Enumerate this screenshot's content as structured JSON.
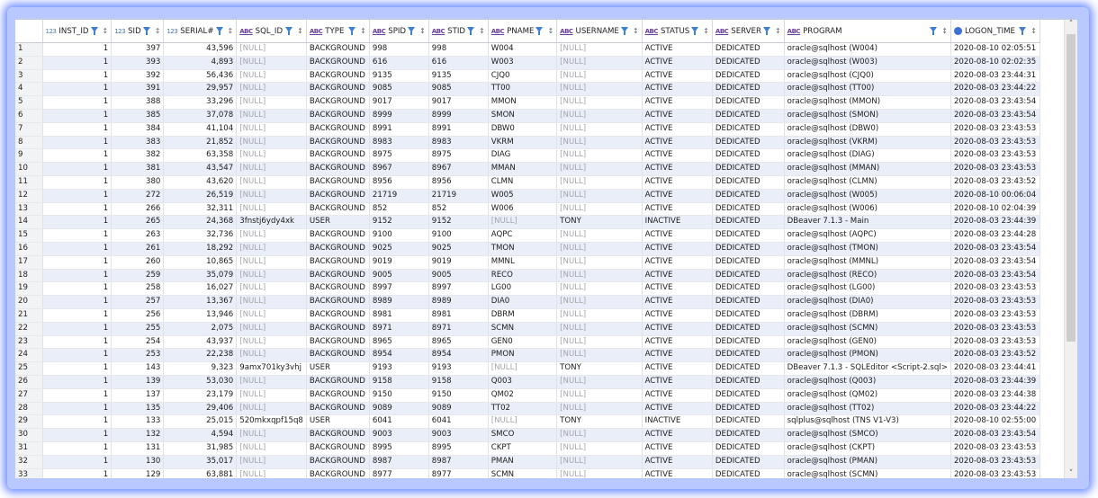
{
  "columns": [
    {
      "label": "",
      "icon": ""
    },
    {
      "label": "INST_ID",
      "icon": "123"
    },
    {
      "label": "SID",
      "icon": "123"
    },
    {
      "label": "SERIAL#",
      "icon": "123"
    },
    {
      "label": "SQL_ID",
      "icon": "ABC"
    },
    {
      "label": "TYPE",
      "icon": "ABC"
    },
    {
      "label": "SPID",
      "icon": "ABC"
    },
    {
      "label": "STID",
      "icon": "ABC"
    },
    {
      "label": "PNAME",
      "icon": "ABC"
    },
    {
      "label": "USERNAME",
      "icon": "ABC"
    },
    {
      "label": "STATUS",
      "icon": "ABC"
    },
    {
      "label": "SERVER",
      "icon": "ABC"
    },
    {
      "label": "PROGRAM",
      "icon": "ABC"
    },
    {
      "label": "LOGON_TIME",
      "icon": "clock"
    }
  ],
  "null_text": "[NULL]",
  "rows": [
    [
      "1",
      "1",
      "397",
      "43,596",
      "[NULL]",
      "BACKGROUND",
      "998",
      "998",
      "W004",
      "[NULL]",
      "ACTIVE",
      "DEDICATED",
      "oracle@sqlhost (W004)",
      "2020-08-10 02:05:51"
    ],
    [
      "2",
      "1",
      "393",
      "4,893",
      "[NULL]",
      "BACKGROUND",
      "616",
      "616",
      "W003",
      "[NULL]",
      "ACTIVE",
      "DEDICATED",
      "oracle@sqlhost (W003)",
      "2020-08-10 02:02:35"
    ],
    [
      "3",
      "1",
      "392",
      "56,436",
      "[NULL]",
      "BACKGROUND",
      "9135",
      "9135",
      "CJQ0",
      "[NULL]",
      "ACTIVE",
      "DEDICATED",
      "oracle@sqlhost (CJQ0)",
      "2020-08-03 23:44:31"
    ],
    [
      "4",
      "1",
      "391",
      "29,957",
      "[NULL]",
      "BACKGROUND",
      "9085",
      "9085",
      "TT00",
      "[NULL]",
      "ACTIVE",
      "DEDICATED",
      "oracle@sqlhost (TT00)",
      "2020-08-03 23:44:22"
    ],
    [
      "5",
      "1",
      "388",
      "33,296",
      "[NULL]",
      "BACKGROUND",
      "9017",
      "9017",
      "MMON",
      "[NULL]",
      "ACTIVE",
      "DEDICATED",
      "oracle@sqlhost (MMON)",
      "2020-08-03 23:43:54"
    ],
    [
      "6",
      "1",
      "385",
      "37,078",
      "[NULL]",
      "BACKGROUND",
      "8999",
      "8999",
      "SMON",
      "[NULL]",
      "ACTIVE",
      "DEDICATED",
      "oracle@sqlhost (SMON)",
      "2020-08-03 23:43:54"
    ],
    [
      "7",
      "1",
      "384",
      "41,104",
      "[NULL]",
      "BACKGROUND",
      "8991",
      "8991",
      "DBW0",
      "[NULL]",
      "ACTIVE",
      "DEDICATED",
      "oracle@sqlhost (DBW0)",
      "2020-08-03 23:43:53"
    ],
    [
      "8",
      "1",
      "383",
      "21,852",
      "[NULL]",
      "BACKGROUND",
      "8983",
      "8983",
      "VKRM",
      "[NULL]",
      "ACTIVE",
      "DEDICATED",
      "oracle@sqlhost (VKRM)",
      "2020-08-03 23:43:53"
    ],
    [
      "9",
      "1",
      "382",
      "63,358",
      "[NULL]",
      "BACKGROUND",
      "8975",
      "8975",
      "DIAG",
      "[NULL]",
      "ACTIVE",
      "DEDICATED",
      "oracle@sqlhost (DIAG)",
      "2020-08-03 23:43:53"
    ],
    [
      "10",
      "1",
      "381",
      "43,547",
      "[NULL]",
      "BACKGROUND",
      "8967",
      "8967",
      "MMAN",
      "[NULL]",
      "ACTIVE",
      "DEDICATED",
      "oracle@sqlhost (MMAN)",
      "2020-08-03 23:43:53"
    ],
    [
      "11",
      "1",
      "380",
      "43,620",
      "[NULL]",
      "BACKGROUND",
      "8956",
      "8956",
      "CLMN",
      "[NULL]",
      "ACTIVE",
      "DEDICATED",
      "oracle@sqlhost (CLMN)",
      "2020-08-03 23:43:52"
    ],
    [
      "12",
      "1",
      "272",
      "26,519",
      "[NULL]",
      "BACKGROUND",
      "21719",
      "21719",
      "W005",
      "[NULL]",
      "ACTIVE",
      "DEDICATED",
      "oracle@sqlhost (W005)",
      "2020-08-10 00:06:04"
    ],
    [
      "13",
      "1",
      "266",
      "32,311",
      "[NULL]",
      "BACKGROUND",
      "852",
      "852",
      "W006",
      "[NULL]",
      "ACTIVE",
      "DEDICATED",
      "oracle@sqlhost (W006)",
      "2020-08-10 02:04:39"
    ],
    [
      "14",
      "1",
      "265",
      "24,368",
      "3fnstj6ydy4xk",
      "USER",
      "9152",
      "9152",
      "[NULL]",
      "TONY",
      "INACTIVE",
      "DEDICATED",
      "DBeaver 7.1.3 - Main",
      "2020-08-03 23:44:39"
    ],
    [
      "15",
      "1",
      "263",
      "32,736",
      "[NULL]",
      "BACKGROUND",
      "9100",
      "9100",
      "AQPC",
      "[NULL]",
      "ACTIVE",
      "DEDICATED",
      "oracle@sqlhost (AQPC)",
      "2020-08-03 23:44:28"
    ],
    [
      "16",
      "1",
      "261",
      "18,292",
      "[NULL]",
      "BACKGROUND",
      "9025",
      "9025",
      "TMON",
      "[NULL]",
      "ACTIVE",
      "DEDICATED",
      "oracle@sqlhost (TMON)",
      "2020-08-03 23:43:54"
    ],
    [
      "17",
      "1",
      "260",
      "10,865",
      "[NULL]",
      "BACKGROUND",
      "9019",
      "9019",
      "MMNL",
      "[NULL]",
      "ACTIVE",
      "DEDICATED",
      "oracle@sqlhost (MMNL)",
      "2020-08-03 23:43:54"
    ],
    [
      "18",
      "1",
      "259",
      "35,079",
      "[NULL]",
      "BACKGROUND",
      "9005",
      "9005",
      "RECO",
      "[NULL]",
      "ACTIVE",
      "DEDICATED",
      "oracle@sqlhost (RECO)",
      "2020-08-03 23:43:54"
    ],
    [
      "19",
      "1",
      "258",
      "16,027",
      "[NULL]",
      "BACKGROUND",
      "8997",
      "8997",
      "LG00",
      "[NULL]",
      "ACTIVE",
      "DEDICATED",
      "oracle@sqlhost (LG00)",
      "2020-08-03 23:43:53"
    ],
    [
      "20",
      "1",
      "257",
      "13,367",
      "[NULL]",
      "BACKGROUND",
      "8989",
      "8989",
      "DIA0",
      "[NULL]",
      "ACTIVE",
      "DEDICATED",
      "oracle@sqlhost (DIA0)",
      "2020-08-03 23:43:53"
    ],
    [
      "21",
      "1",
      "256",
      "13,946",
      "[NULL]",
      "BACKGROUND",
      "8981",
      "8981",
      "DBRM",
      "[NULL]",
      "ACTIVE",
      "DEDICATED",
      "oracle@sqlhost (DBRM)",
      "2020-08-03 23:43:53"
    ],
    [
      "22",
      "1",
      "255",
      "2,075",
      "[NULL]",
      "BACKGROUND",
      "8971",
      "8971",
      "SCMN",
      "[NULL]",
      "ACTIVE",
      "DEDICATED",
      "oracle@sqlhost (SCMN)",
      "2020-08-03 23:43:53"
    ],
    [
      "23",
      "1",
      "254",
      "43,937",
      "[NULL]",
      "BACKGROUND",
      "8965",
      "8965",
      "GEN0",
      "[NULL]",
      "ACTIVE",
      "DEDICATED",
      "oracle@sqlhost (GEN0)",
      "2020-08-03 23:43:53"
    ],
    [
      "24",
      "1",
      "253",
      "22,238",
      "[NULL]",
      "BACKGROUND",
      "8954",
      "8954",
      "PMON",
      "[NULL]",
      "ACTIVE",
      "DEDICATED",
      "oracle@sqlhost (PMON)",
      "2020-08-03 23:43:52"
    ],
    [
      "25",
      "1",
      "143",
      "9,323",
      "9amx701ky3vhj",
      "USER",
      "9193",
      "9193",
      "[NULL]",
      "TONY",
      "ACTIVE",
      "DEDICATED",
      "DBeaver 7.1.3 - SQLEditor <Script-2.sql>",
      "2020-08-03 23:44:41"
    ],
    [
      "26",
      "1",
      "139",
      "53,030",
      "[NULL]",
      "BACKGROUND",
      "9158",
      "9158",
      "Q003",
      "[NULL]",
      "ACTIVE",
      "DEDICATED",
      "oracle@sqlhost (Q003)",
      "2020-08-03 23:44:39"
    ],
    [
      "27",
      "1",
      "137",
      "23,179",
      "[NULL]",
      "BACKGROUND",
      "9150",
      "9150",
      "QM02",
      "[NULL]",
      "ACTIVE",
      "DEDICATED",
      "oracle@sqlhost (QM02)",
      "2020-08-03 23:44:38"
    ],
    [
      "28",
      "1",
      "135",
      "29,406",
      "[NULL]",
      "BACKGROUND",
      "9089",
      "9089",
      "TT02",
      "[NULL]",
      "ACTIVE",
      "DEDICATED",
      "oracle@sqlhost (TT02)",
      "2020-08-03 23:44:22"
    ],
    [
      "29",
      "1",
      "133",
      "25,015",
      "520mkxqpf15q8",
      "USER",
      "6041",
      "6041",
      "[NULL]",
      "TONY",
      "INACTIVE",
      "DEDICATED",
      "sqlplus@sqlhost (TNS V1-V3)",
      "2020-08-10 02:55:00"
    ],
    [
      "30",
      "1",
      "132",
      "4,594",
      "[NULL]",
      "BACKGROUND",
      "9003",
      "9003",
      "SMCO",
      "[NULL]",
      "ACTIVE",
      "DEDICATED",
      "oracle@sqlhost (SMCO)",
      "2020-08-03 23:43:54"
    ],
    [
      "31",
      "1",
      "131",
      "31,985",
      "[NULL]",
      "BACKGROUND",
      "8995",
      "8995",
      "CKPT",
      "[NULL]",
      "ACTIVE",
      "DEDICATED",
      "oracle@sqlhost (CKPT)",
      "2020-08-03 23:43:53"
    ],
    [
      "32",
      "1",
      "130",
      "35,017",
      "[NULL]",
      "BACKGROUND",
      "8987",
      "8987",
      "PMAN",
      "[NULL]",
      "ACTIVE",
      "DEDICATED",
      "oracle@sqlhost (PMAN)",
      "2020-08-03 23:43:53"
    ],
    [
      "33",
      "1",
      "129",
      "63,881",
      "[NULL]",
      "BACKGROUND",
      "8977",
      "8977",
      "SCMN",
      "[NULL]",
      "ACTIVE",
      "DEDICATED",
      "oracle@sqlhost (SCMN)",
      "2020-08-03 23:43:53"
    ]
  ],
  "scrollbar": {
    "up_glyph": "˄",
    "down_glyph": "˅"
  }
}
